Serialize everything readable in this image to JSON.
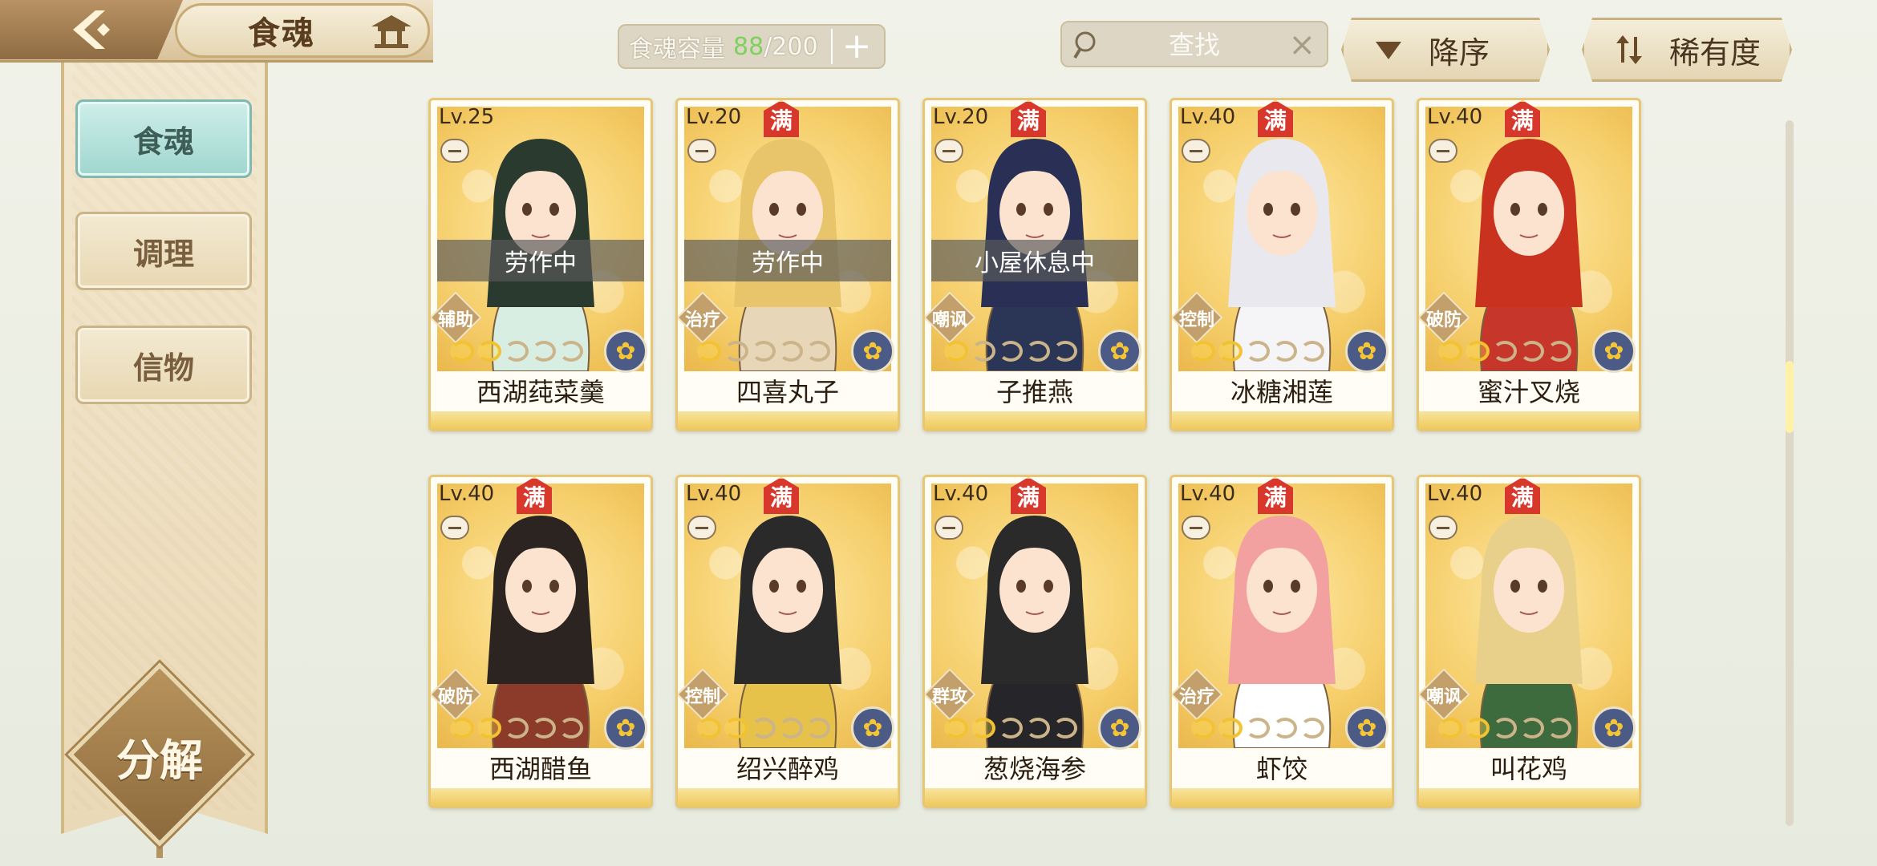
{
  "header": {
    "title": "食魂",
    "capacity_label": "食魂容量",
    "capacity_current": "88",
    "capacity_sep": "/200",
    "plus": "+",
    "search_placeholder": "查找",
    "clear": "×",
    "sort_order": "降序",
    "sort_key": "稀有度"
  },
  "sidebar": {
    "items": [
      {
        "label": "食魂",
        "active": true
      },
      {
        "label": "调理",
        "active": false
      },
      {
        "label": "信物",
        "active": false
      }
    ],
    "decompose": "分解"
  },
  "cards": [
    {
      "level": "Lv.25",
      "full": "",
      "status": "劳作中",
      "role": "辅助",
      "name": "西湖莼菜羹",
      "stars": 2
    },
    {
      "level": "Lv.20",
      "full": "满",
      "status": "劳作中",
      "role": "治疗",
      "name": "四喜丸子",
      "stars": 1
    },
    {
      "level": "Lv.20",
      "full": "满",
      "status": "小屋休息中",
      "role": "嘲讽",
      "name": "子推燕",
      "stars": 1
    },
    {
      "level": "Lv.40",
      "full": "满",
      "status": "",
      "role": "控制",
      "name": "冰糖湘莲",
      "stars": 2
    },
    {
      "level": "Lv.40",
      "full": "满",
      "status": "",
      "role": "破防",
      "name": "蜜汁叉烧",
      "stars": 2
    },
    {
      "level": "Lv.40",
      "full": "满",
      "status": "",
      "role": "破防",
      "name": "西湖醋鱼",
      "stars": 2
    },
    {
      "level": "Lv.40",
      "full": "满",
      "status": "",
      "role": "控制",
      "name": "绍兴醉鸡",
      "stars": 2
    },
    {
      "level": "Lv.40",
      "full": "满",
      "status": "",
      "role": "群攻",
      "name": "葱烧海参",
      "stars": 2
    },
    {
      "level": "Lv.40",
      "full": "满",
      "status": "",
      "role": "治疗",
      "name": "虾饺",
      "stars": 2
    },
    {
      "level": "Lv.40",
      "full": "满",
      "status": "",
      "role": "嘲讽",
      "name": "叫花鸡",
      "stars": 2
    }
  ],
  "icons": {
    "back": "back-arrow-icon",
    "title": "pavilion-icon",
    "search": "search-icon",
    "sort_desc": "triangle-down-icon",
    "sort_rarity": "sort-arrows-icon",
    "element": "flower-icon"
  },
  "colors": {
    "accent_teal": "#9fd6cf",
    "card_gold": "#e7c774",
    "full_badge_red": "#d8382c",
    "capacity_green": "#7fd05e"
  }
}
